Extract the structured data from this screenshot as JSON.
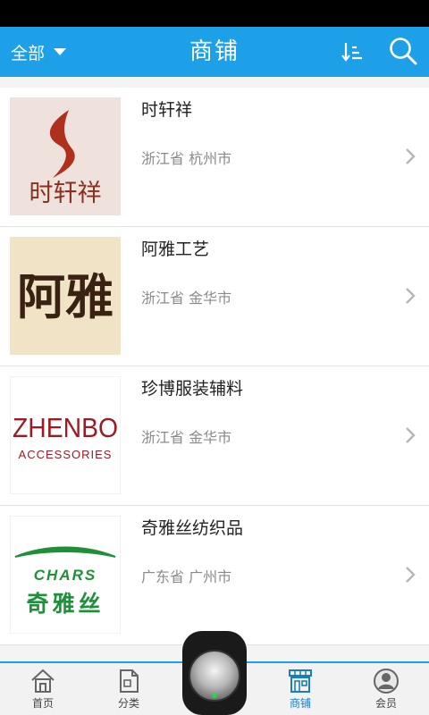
{
  "header": {
    "filter_label": "全部",
    "title": "商铺"
  },
  "shops": [
    {
      "name": "时轩祥",
      "location": "浙江省 杭州市",
      "logo_text": "时轩祥"
    },
    {
      "name": "阿雅工艺",
      "location": "浙江省 金华市",
      "logo_text": "阿雅"
    },
    {
      "name": "珍博服装辅料",
      "location": "浙江省 金华市",
      "logo_text": "ZHENBO",
      "logo_subtext": "ACCESSORIES"
    },
    {
      "name": "奇雅丝纺织品",
      "location": "广东省 广州市",
      "logo_text": "奇雅丝",
      "logo_subtext": "CHARS"
    }
  ],
  "nav": {
    "tabs": [
      {
        "label": "首页",
        "icon": "home-icon"
      },
      {
        "label": "分类",
        "icon": "category-icon"
      },
      {
        "label": "商铺",
        "icon": "shop-icon",
        "active": true
      },
      {
        "label": "会员",
        "icon": "member-icon"
      }
    ]
  },
  "colors": {
    "accent": "#1ea0e8",
    "status_bar": "#000000"
  }
}
